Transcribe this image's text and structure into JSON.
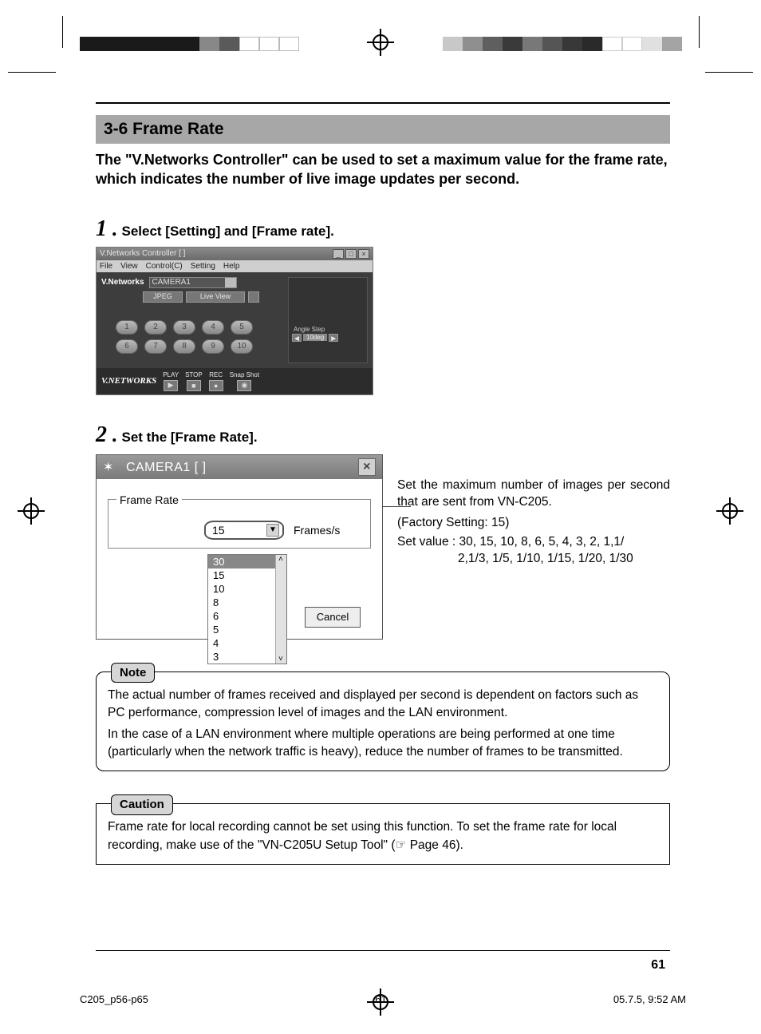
{
  "header": {
    "title": "3-6 Frame Rate"
  },
  "intro": "The \"V.Networks Controller\" can be used to set a maximum value for the frame rate, which indicates the number of live image updates per second.",
  "steps": {
    "s1": {
      "num": "1",
      "dot": ".",
      "text": "Select [Setting] and [Frame rate]."
    },
    "s2": {
      "num": "2",
      "dot": ".",
      "text": "Set the [Frame Rate]."
    }
  },
  "shot1": {
    "title": "V.Networks Controller  [ ]",
    "win_min": "_",
    "win_max": "□",
    "win_close": "×",
    "menu": [
      "File",
      "View",
      "Control(C)",
      "Setting",
      "Help"
    ],
    "vn_label": "V.Networks",
    "vn_value": "CAMERA1",
    "btn_jpeg": "JPEG",
    "btn_live": "Live View",
    "nums1": [
      "1",
      "2",
      "3",
      "4",
      "5"
    ],
    "nums2": [
      "6",
      "7",
      "8",
      "9",
      "10"
    ],
    "ctrls": {
      "play": "PLAY",
      "stop": "STOP",
      "rec": "REC",
      "snap": "Snap Shot"
    },
    "glyph_play": "▶",
    "glyph_stop": "■",
    "glyph_rec": "●",
    "glyph_snap": "◉",
    "logo": "V.NETWORKS",
    "angle_label": "Angle Step",
    "angle_val": "10deg"
  },
  "shot2": {
    "title": "CAMERA1  [ ]",
    "close": "×",
    "legend": "Frame Rate",
    "value": "15",
    "arrow": "▼",
    "unit": "Frames/s",
    "options": [
      "30",
      "15",
      "10",
      "8",
      "6",
      "5",
      "4",
      "3"
    ],
    "selected_index": 0,
    "cancel": "Cancel"
  },
  "side": {
    "p1": "Set the maximum number of images per second that are sent from VN-C205.",
    "p2": "(Factory Setting: 15)",
    "p3": "Set value : 30, 15, 10, 8, 6, 5, 4, 3, 2, 1,1/",
    "p3b": "2,1/3, 1/5, 1/10, 1/15, 1/20, 1/30"
  },
  "note": {
    "tag": "Note",
    "p1": "The actual number of frames received and displayed per second is dependent on factors such as PC performance, compression level of images and the LAN environment.",
    "p2": "In the case of a LAN environment where multiple operations are being performed at one time (particularly when the network traffic is heavy), reduce the number of frames to be transmitted."
  },
  "caution": {
    "tag": "Caution",
    "p1": "Frame rate for local recording cannot be set using this function. To set the frame rate for local recording, make use of the \"VN-C205U Setup Tool\" (☞ Page 46)."
  },
  "page_no": "61",
  "foot": {
    "left": "C205_p56-p65",
    "center": "61",
    "right": "05.7.5, 9:52 AM"
  }
}
